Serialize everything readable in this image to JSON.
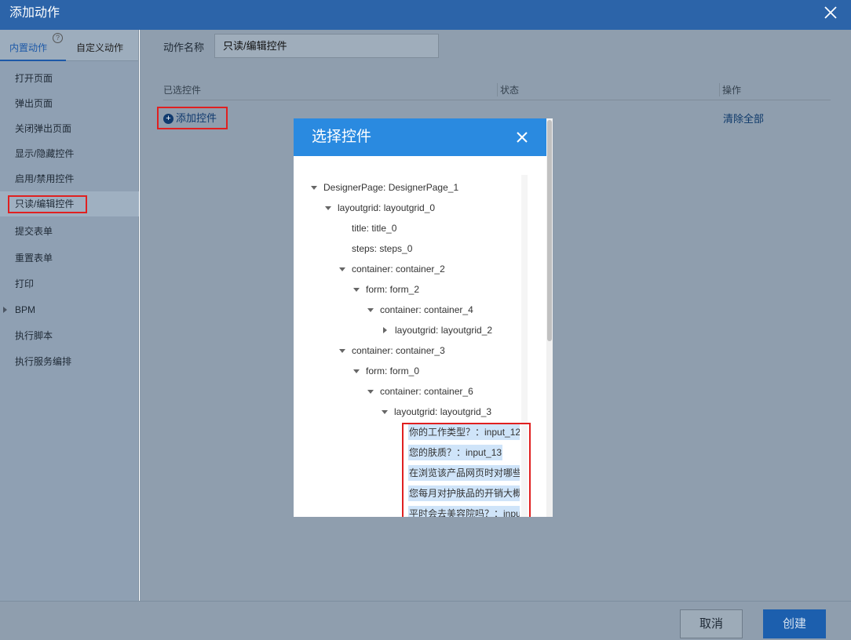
{
  "dialog": {
    "title": "添加动作",
    "close_icon": "close-icon"
  },
  "left_panel": {
    "tabs": [
      {
        "label": "内置动作",
        "active": true
      },
      {
        "label": "自定义动作",
        "active": false
      }
    ],
    "help_glyph": "?",
    "items": [
      {
        "label": "打开页面"
      },
      {
        "label": "弹出页面"
      },
      {
        "label": "关闭弹出页面"
      },
      {
        "label": "显示/隐藏控件"
      },
      {
        "label": "启用/禁用控件"
      },
      {
        "label": "只读/编辑控件",
        "selected": true
      },
      {
        "label": "提交表单"
      },
      {
        "label": "重置表单"
      },
      {
        "label": "打印"
      },
      {
        "label": "BPM",
        "expandable": true
      },
      {
        "label": "执行脚本"
      },
      {
        "label": "执行服务编排"
      }
    ]
  },
  "main": {
    "name_label": "动作名称",
    "name_value": "只读/编辑控件",
    "columns": [
      "已选控件",
      "状态",
      "操作"
    ],
    "add_button": "添加控件",
    "clear_all": "清除全部"
  },
  "modal": {
    "title": "选择控件",
    "tree": [
      {
        "label": "DesignerPage: DesignerPage_1",
        "expanded": true
      },
      {
        "label": "layoutgrid: layoutgrid_0",
        "expanded": true
      },
      {
        "label": "title: title_0"
      },
      {
        "label": "steps: steps_0"
      },
      {
        "label": "container: container_2",
        "expanded": true
      },
      {
        "label": "form: form_2",
        "expanded": true
      },
      {
        "label": "container: container_4",
        "expanded": true
      },
      {
        "label": "layoutgrid: layoutgrid_2",
        "expanded": false
      },
      {
        "label": "container: container_3",
        "expanded": true
      },
      {
        "label": "form: form_0",
        "expanded": true
      },
      {
        "label": "container: container_6",
        "expanded": true
      },
      {
        "label": "layoutgrid: layoutgrid_3",
        "expanded": true
      },
      {
        "label": "你的工作类型？：input_12",
        "highlighted": true
      },
      {
        "label": "您的肤质？：input_13",
        "highlighted": true
      },
      {
        "label": "在浏览该产品网页时对哪些",
        "highlighted": true
      },
      {
        "label": "您每月对护肤品的开销大概",
        "highlighted": true
      },
      {
        "label": "平时会去美容院吗？：input",
        "highlighted": true
      }
    ]
  },
  "footer": {
    "cancel": "取消",
    "create": "创建"
  },
  "colors": {
    "title_bar": "#2c64a9",
    "modal_header": "#2a8ae0",
    "primary_button": "#1c5fae",
    "highlight_box": "#e02020"
  }
}
